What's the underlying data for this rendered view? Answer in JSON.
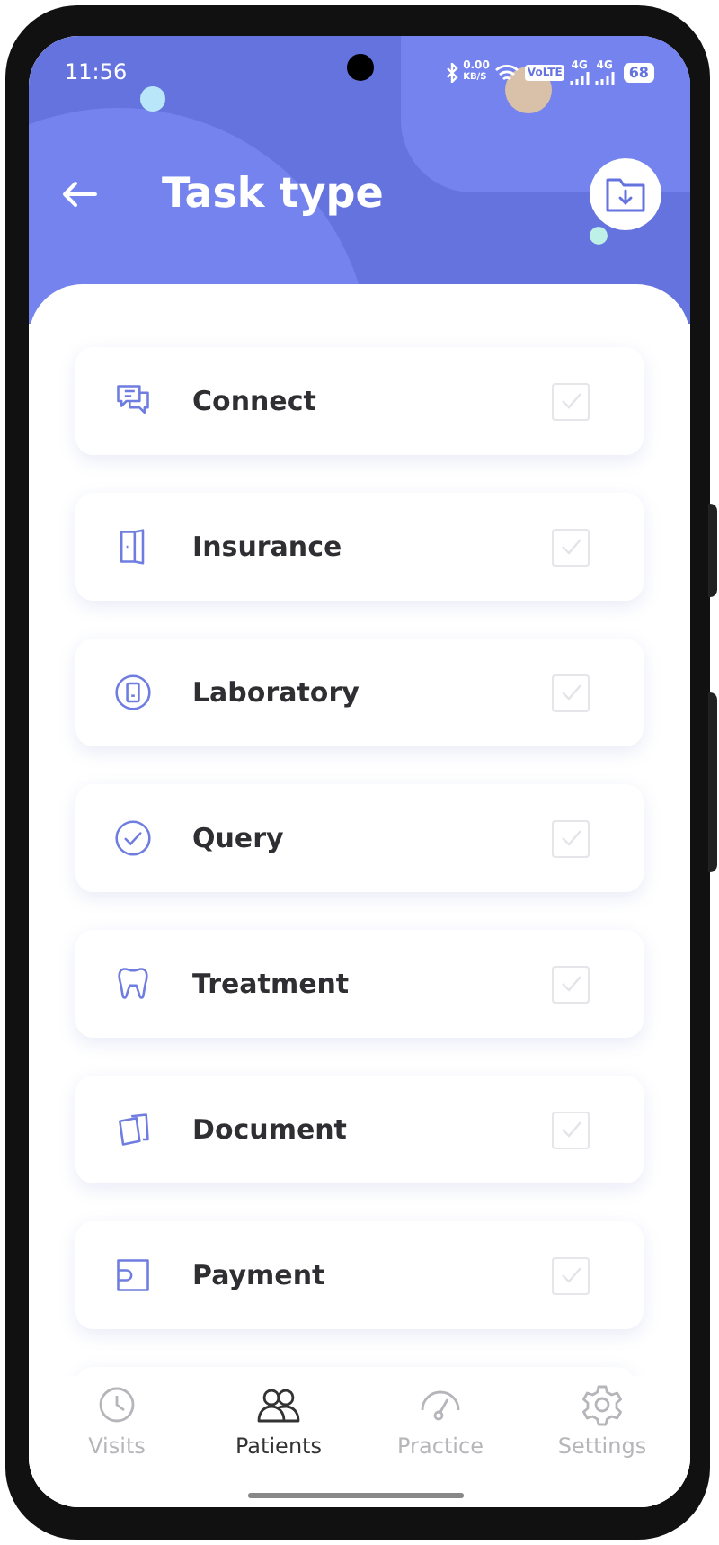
{
  "status_bar": {
    "time": "11:56",
    "speed_value": "0.00",
    "speed_unit": "KB/S",
    "volte": "VoLTE",
    "network_1": "4G",
    "network_2": "4G",
    "battery": "68"
  },
  "header": {
    "title": "Task type"
  },
  "task_types": [
    {
      "kind": "chat",
      "label": "Connect",
      "checked": false
    },
    {
      "kind": "door",
      "label": "Insurance",
      "checked": false
    },
    {
      "kind": "phone",
      "label": "Laboratory",
      "checked": false
    },
    {
      "kind": "check",
      "label": "Query",
      "checked": false
    },
    {
      "kind": "tooth",
      "label": "Treatment",
      "checked": false
    },
    {
      "kind": "cards",
      "label": "Document",
      "checked": false
    },
    {
      "kind": "wallet",
      "label": "Payment",
      "checked": false
    }
  ],
  "bottom_nav": [
    {
      "kind": "clock",
      "label": "Visits",
      "selected": false
    },
    {
      "kind": "people",
      "label": "Patients",
      "selected": true
    },
    {
      "kind": "gauge",
      "label": "Practice",
      "selected": false
    },
    {
      "kind": "gear",
      "label": "Settings",
      "selected": false
    }
  ]
}
